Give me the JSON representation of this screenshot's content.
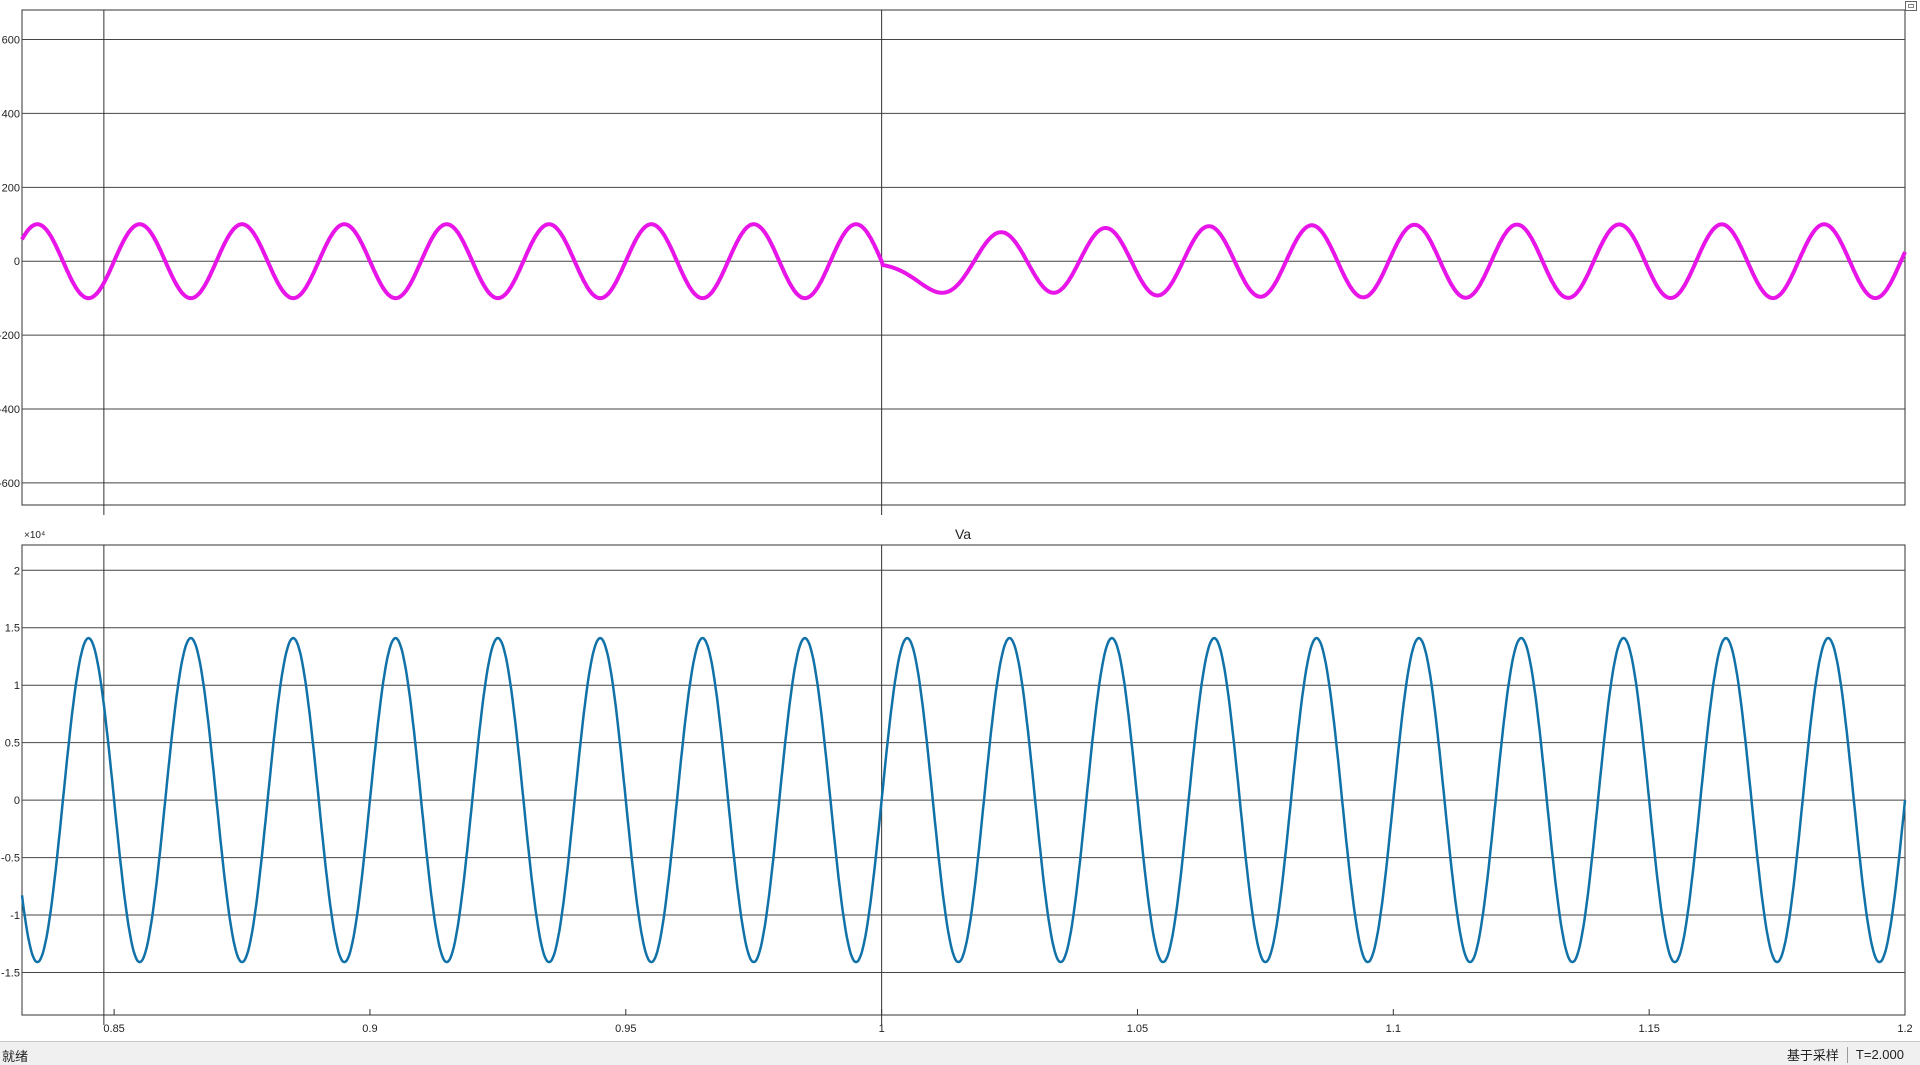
{
  "window": {
    "title": ""
  },
  "status_bar": {
    "left_text": "就绪",
    "sample_mode": "基于采样",
    "time_offset": "T=2.000"
  },
  "icons": {
    "maximize": "maximize-icon"
  },
  "colors": {
    "top_series": "#e815e8",
    "bottom_series": "#1072a8",
    "grid": "#444444",
    "cursor": "#333333",
    "background": "#ffffff"
  },
  "cursors": {
    "t1": 0.848,
    "t2": 1.0
  },
  "chart_data": [
    {
      "type": "line",
      "title": "",
      "xlabel": "",
      "ylabel": "",
      "xlim": [
        0.832,
        1.2
      ],
      "ylim": [
        -660,
        680
      ],
      "yticks": [
        {
          "value": 600,
          "label": "600"
        },
        {
          "value": 400,
          "label": "400"
        },
        {
          "value": 200,
          "label": "200"
        },
        {
          "value": 0,
          "label": "0"
        },
        {
          "value": -200,
          "label": "-200"
        },
        {
          "value": -400,
          "label": "-400"
        },
        {
          "value": -600,
          "label": "-600"
        }
      ],
      "grid": true,
      "series": [
        {
          "color": "#e815e8",
          "description": "sinusoid ~50 Hz, amplitude ~100 before t=1.0; disturbance at t=1.0 (dip ~60, peaks ~150 / ~-145 near t=1.04), settling back to ~100 after t=1.09"
        }
      ]
    },
    {
      "type": "line",
      "title": "Va",
      "xlabel": "",
      "ylabel": "",
      "y_exponent": "×10⁴",
      "xlim": [
        0.832,
        1.2
      ],
      "ylim": [
        -1.87,
        2.22
      ],
      "xticks": [
        {
          "value": 0.85,
          "label": "0.85"
        },
        {
          "value": 0.9,
          "label": "0.9"
        },
        {
          "value": 0.95,
          "label": "0.95"
        },
        {
          "value": 1.0,
          "label": "1"
        },
        {
          "value": 1.05,
          "label": "1.05"
        },
        {
          "value": 1.1,
          "label": "1.1"
        },
        {
          "value": 1.15,
          "label": "1.15"
        },
        {
          "value": 1.2,
          "label": "1.2"
        }
      ],
      "yticks": [
        {
          "value": 2,
          "label": "2"
        },
        {
          "value": 1.5,
          "label": "1.5"
        },
        {
          "value": 1,
          "label": "1"
        },
        {
          "value": 0.5,
          "label": "0.5"
        },
        {
          "value": 0,
          "label": "0"
        },
        {
          "value": -0.5,
          "label": "-0.5"
        },
        {
          "value": -1,
          "label": "-1"
        },
        {
          "value": -1.5,
          "label": "-1.5"
        }
      ],
      "grid": true,
      "series": [
        {
          "color": "#1072a8",
          "amplitude": 1.41,
          "frequency_hz": 50,
          "phase_reference": "rising zero crossing at t=1.0"
        }
      ]
    }
  ]
}
